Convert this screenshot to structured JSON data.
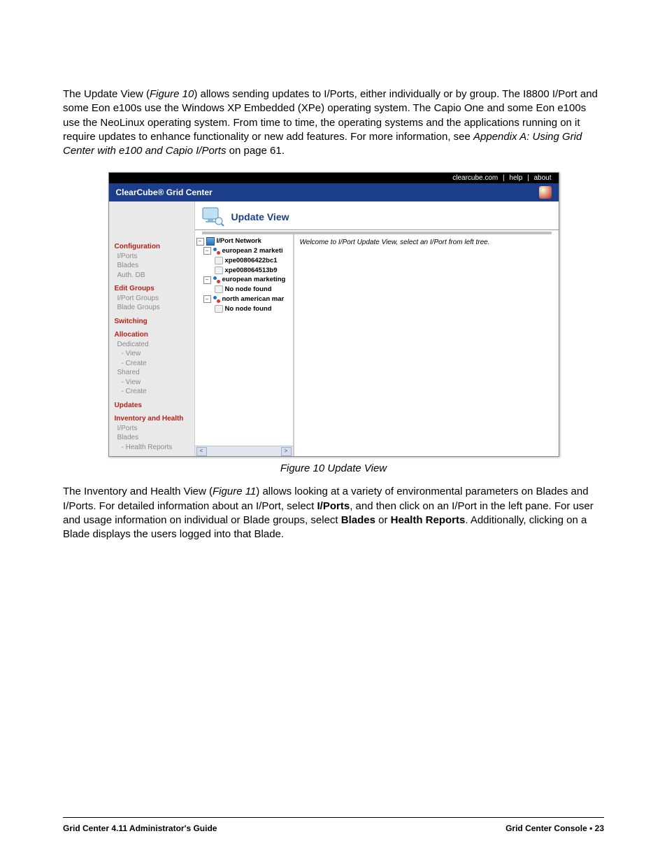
{
  "paragraph1": {
    "s1a": "The Update View (",
    "s1b": "Figure 10",
    "s1c": ") allows sending updates to I/Ports, either individually or by group. The I8800 I/Port and some Eon e100s use the Windows XP Embedded (XPe) operating system. The Capio One and some Eon e100s use the NeoLinux operating system. From time to time, the operating systems and the applications running on it require updates to enhance functionality or new add features. For more information, see ",
    "s1d": "Appendix A: Using Grid Center with e100 and Capio I/Ports",
    "s1e": " on page 61."
  },
  "figure_caption": "Figure 10  Update View",
  "paragraph2": {
    "s2a": "The Inventory and Health View (",
    "s2b": "Figure 11",
    "s2c": ") allows looking at a variety of environmental parameters on Blades and I/Ports. For detailed information about an I/Port, select ",
    "s2d": "I/Ports",
    "s2e": ", and then click on an I/Port in the left pane. For user and usage information on individual or Blade groups, select ",
    "s2f": "Blades",
    "s2g": " or ",
    "s2h": "Health Reports",
    "s2i": ". Additionally, clicking on a Blade displays the users logged into that Blade."
  },
  "footer": {
    "left": "Grid Center 4.11 Administrator's Guide",
    "right_section": "Grid Center Console",
    "right_sep": " • ",
    "right_page": "23"
  },
  "app": {
    "headerbar": {
      "site": "clearcube.com",
      "sep": " | ",
      "help": "help",
      "about": "about"
    },
    "bluebar_title": "ClearCube® Grid Center",
    "main_title": "Update View",
    "detail_message": "Welcome to I/Port Update View, select an I/Port from left tree.",
    "sidebar": {
      "configuration": "Configuration",
      "iports": "I/Ports",
      "blades": "Blades",
      "authdb": "Auth. DB",
      "edit_groups": "Edit Groups",
      "iport_groups": "I/Port Groups",
      "blade_groups": "Blade Groups",
      "switching": "Switching",
      "allocation": "Allocation",
      "dedicated": "Dedicated",
      "view1": "- View",
      "create1": "- Create",
      "shared": "Shared",
      "view2": "- View",
      "create2": "- Create",
      "updates": "Updates",
      "inv_health": "Inventory and Health",
      "iports2": "I/Ports",
      "blades2": "Blades",
      "health_reports": "- Health Reports"
    },
    "tree": {
      "root": "I/Port Network",
      "g1": "european 2 marketi",
      "g1n1": "xpe00806422bc1",
      "g1n2": "xpe008064513b9",
      "g2": "european marketing",
      "g2n1": "No node found",
      "g3": "north american mar",
      "g3n1": "No node found"
    }
  }
}
